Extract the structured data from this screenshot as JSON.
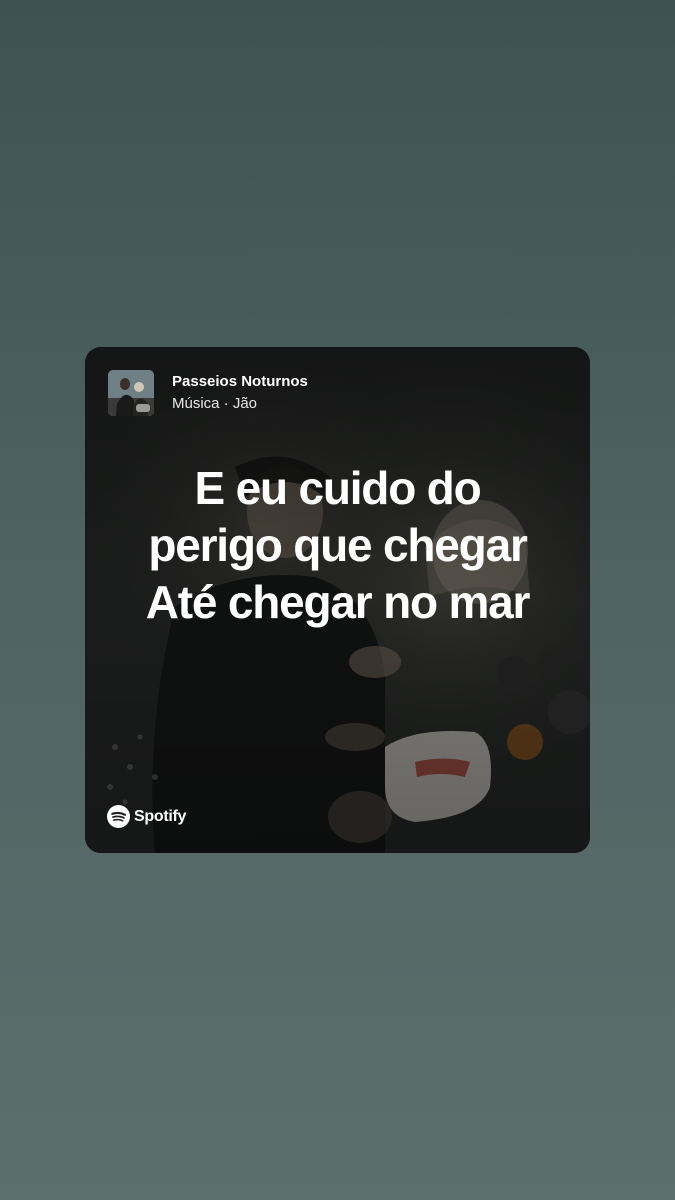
{
  "track": {
    "title": "Passeios Noturnos",
    "subtitle": "Música · Jão"
  },
  "lyrics": {
    "lines": [
      "E eu cuido do",
      "perigo que chegar",
      "Até chegar no mar"
    ]
  },
  "brand": {
    "name": "Spotify",
    "icon": "spotify-logo-icon"
  },
  "colors": {
    "background_top": "#3f5252",
    "background_bottom": "#5d6f6c",
    "card": "#1c1e1d",
    "text": "#ffffff"
  }
}
